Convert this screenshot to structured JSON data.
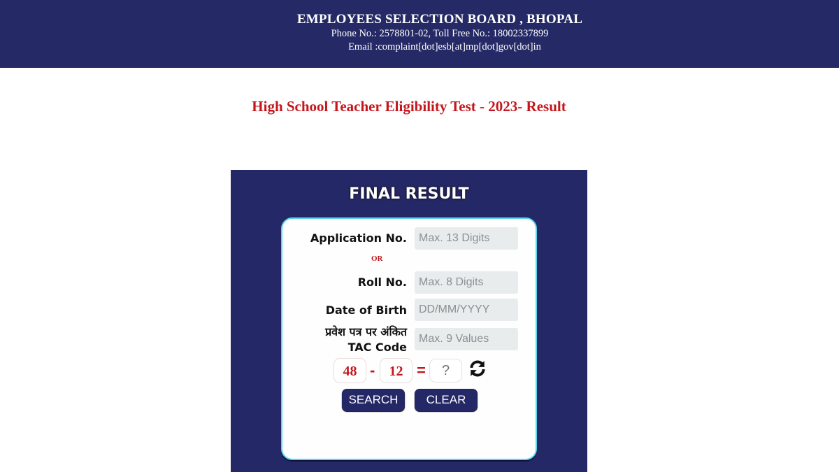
{
  "header": {
    "org_name": "EMPLOYEES SELECTION BOARD , BHOPAL",
    "phone_line": "Phone No.: 2578801-02, Toll Free No.: 18002337899",
    "email_line": "Email :complaint[dot]esb[at]mp[dot]gov[dot]in"
  },
  "page_title": "High School Teacher Eligibility Test - 2023- Result",
  "form": {
    "title": "FINAL RESULT",
    "application_label": "Application No.",
    "application_placeholder": "Max. 13 Digits",
    "application_value": "",
    "or_label": "OR",
    "roll_label": "Roll No.",
    "roll_placeholder": "Max. 8 Digits",
    "roll_value": "",
    "dob_label": "Date of Birth",
    "dob_placeholder": "DD/MM/YYYY",
    "dob_value": "",
    "tac_label_hindi": "प्रवेश पत्र पर अंकित",
    "tac_label": "TAC Code",
    "tac_placeholder": "Max. 9 Values",
    "tac_value": "",
    "captcha": {
      "operand1": "48",
      "operator": "-",
      "operand2": "12",
      "equals": "=",
      "answer_placeholder": "?",
      "refresh_icon": "refresh-icon"
    },
    "search_label": "SEARCH",
    "clear_label": "CLEAR"
  },
  "colors": {
    "header_bg": "#252a66",
    "title_red": "#c4161c",
    "panel_border": "#5fd3ea",
    "button_bg": "#252866"
  }
}
